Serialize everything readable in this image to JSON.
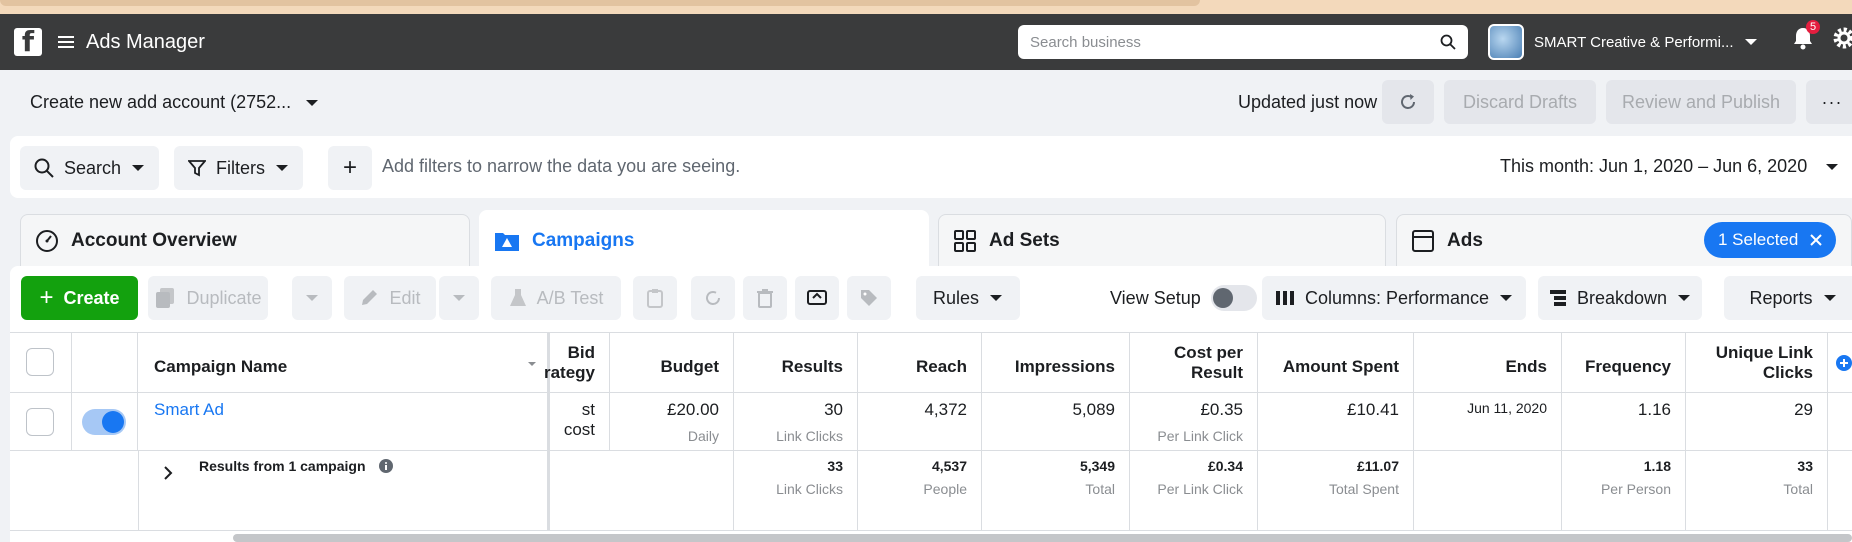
{
  "header": {
    "app_title": "Ads Manager",
    "search_placeholder": "Search business",
    "account_name": "SMART Creative & Performi...",
    "notification_count": "5"
  },
  "account_bar": {
    "account_selector": "Create new add account (2752...",
    "updated_text": "Updated just now",
    "discard_label": "Discard Drafts",
    "review_label": "Review and Publish",
    "more_label": "···"
  },
  "filters": {
    "search_label": "Search",
    "filters_label": "Filters",
    "add_label": "+",
    "hint": "Add filters to narrow the data you are seeing.",
    "date_range": "This month: Jun 1, 2020 – Jun 6, 2020"
  },
  "tabs": [
    {
      "label": "Account Overview"
    },
    {
      "label": "Campaigns"
    },
    {
      "label": "Ad Sets"
    },
    {
      "label": "Ads"
    }
  ],
  "selected_pill": "1 Selected",
  "toolbar": {
    "create": "Create",
    "duplicate": "Duplicate",
    "edit": "Edit",
    "ab_test": "A/B Test",
    "rules": "Rules",
    "view_setup": "View Setup",
    "columns": "Columns: Performance",
    "breakdown": "Breakdown",
    "reports": "Reports"
  },
  "table": {
    "headers": {
      "campaign_name": "Campaign Name",
      "bid_strategy_1": "Bid",
      "bid_strategy_2": "rategy",
      "budget": "Budget",
      "results": "Results",
      "reach": "Reach",
      "impressions": "Impressions",
      "cost_per_result_1": "Cost per",
      "cost_per_result_2": "Result",
      "amount_spent": "Amount Spent",
      "ends": "Ends",
      "frequency": "Frequency",
      "unique_link_clicks_1": "Unique Link",
      "unique_link_clicks_2": "Clicks"
    },
    "row": {
      "name": "Smart Ad",
      "bid": "st cost",
      "budget": "£20.00",
      "budget_sub": "Daily",
      "results": "30",
      "results_sub": "Link Clicks",
      "reach": "4,372",
      "impressions": "5,089",
      "cost_per_result": "£0.35",
      "cost_per_result_sub": "Per Link Click",
      "amount_spent": "£10.41",
      "ends": "Jun 11, 2020",
      "frequency": "1.16",
      "unique_link_clicks": "29"
    },
    "totals": {
      "label": "Results from 1 campaign",
      "results": "33",
      "results_sub": "Link Clicks",
      "reach": "4,537",
      "reach_sub": "People",
      "impressions": "5,349",
      "impressions_sub": "Total",
      "cost_per_result": "£0.34",
      "cost_per_result_sub": "Per Link Click",
      "amount_spent": "£11.07",
      "amount_spent_sub": "Total Spent",
      "frequency": "1.18",
      "frequency_sub": "Per Person",
      "unique_link_clicks": "33",
      "unique_link_clicks_sub": "Total"
    }
  },
  "colors": {
    "header_bg": "#3a3b3c",
    "accent_blue": "#1877f2",
    "create_green": "#13a10e",
    "badge_red": "#e41e3f"
  }
}
